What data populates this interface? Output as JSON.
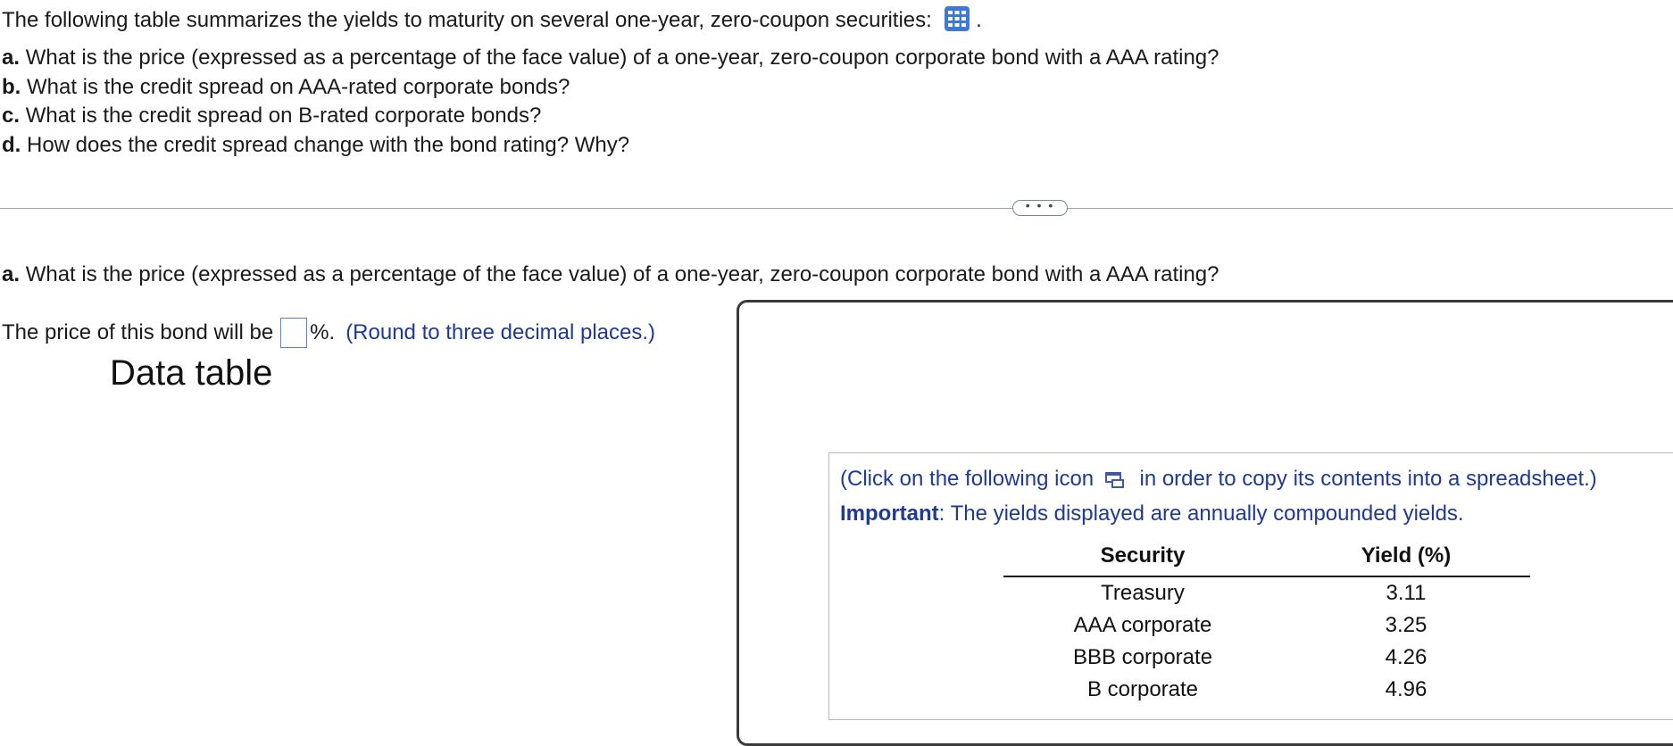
{
  "intro": {
    "text": "The following table summarizes the yields to maturity on several one-year, zero-coupon securities:",
    "trailing": ".",
    "icon": "table-grid-icon"
  },
  "questions": [
    {
      "letter": "a.",
      "text": "What is the price (expressed as a percentage of the face value) of a one-year, zero-coupon corporate bond with a AAA rating?"
    },
    {
      "letter": "b.",
      "text": "What is the credit spread on AAA-rated corporate bonds?"
    },
    {
      "letter": "c.",
      "text": "What is the credit spread on B-rated corporate bonds?"
    },
    {
      "letter": "d.",
      "text": "How does the credit spread change with the bond rating? Why?"
    }
  ],
  "expand_button": {
    "label": "• • •"
  },
  "part_a": {
    "letter": "a.",
    "text": "What is the price (expressed as a percentage of the face value) of a one-year, zero-coupon corporate bond with a AAA rating?"
  },
  "answer": {
    "prefix": "The price of this bond will be",
    "value": "",
    "suffix": "%.",
    "hint": "(Round to three decimal places.)"
  },
  "popup": {
    "title": "Data table",
    "note_before_icon": "(Click on the following icon",
    "note_after_icon": "in order to copy its contents into a spreadsheet.)",
    "important_label": "Important",
    "important_text": ": The yields displayed are annually compounded yields.",
    "table": {
      "headers": [
        "Security",
        "Yield (%)"
      ],
      "rows": [
        [
          "Treasury",
          "3.11"
        ],
        [
          "AAA corporate",
          "3.25"
        ],
        [
          "BBB corporate",
          "4.26"
        ],
        [
          "B corporate",
          "4.96"
        ]
      ]
    }
  },
  "colors": {
    "hint_blue": "#1f3a93",
    "input_border": "#5b7fc4",
    "icon_blue": "#3d7ad6"
  }
}
